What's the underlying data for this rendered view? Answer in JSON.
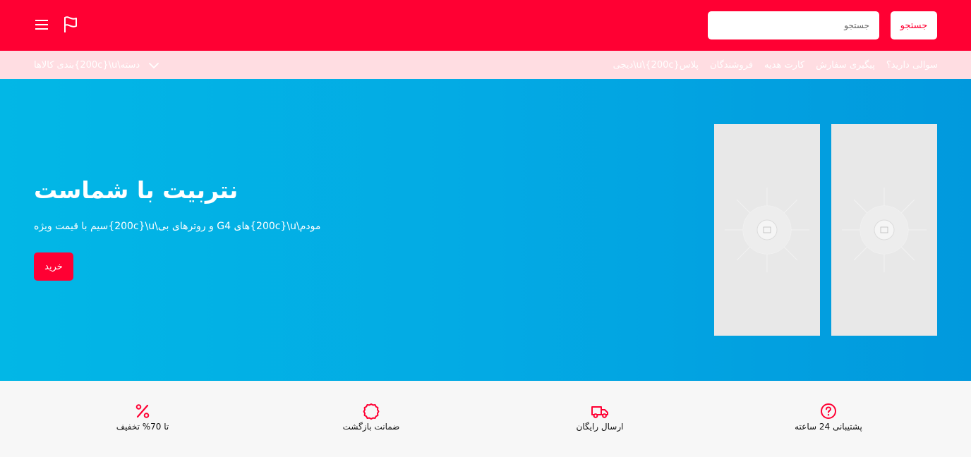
{
  "header": {
    "search_button_label": "جستجو",
    "search_placeholder": "جستجو"
  },
  "subnav": {
    "links": [
      "پلاس{200c}\\u\\دیجی",
      "فروشندگان",
      "کارت هدیه",
      "پیگیری سفارش",
      "سوالی دارید؟"
    ],
    "category_label": "بندی کالاها{200c}\\u\\دسته"
  },
  "hero": {
    "title": "نتربیت با شماست",
    "subtitle": "سیم با قیمت ویژه{200c}\\u\\و روترهای بی Gهای 4{200c}\\u\\مودم",
    "buy_label": "خرید",
    "background_start": "#02b7e6",
    "background_end": "#0199dd"
  },
  "features": [
    {
      "label": "پشتیبانی 24 ساعته",
      "icon": "question-circle-icon"
    },
    {
      "label": "ارسال رایگان",
      "icon": "truck-icon"
    },
    {
      "label": "ضمانت بازگشت",
      "icon": "badge-icon"
    },
    {
      "label": "تا 70% تخفیف",
      "icon": "percent-icon"
    }
  ],
  "colors": {
    "brand": "#ff0033",
    "subnav_bg": "#ffdde2",
    "features_bg": "#f7f7f7"
  }
}
